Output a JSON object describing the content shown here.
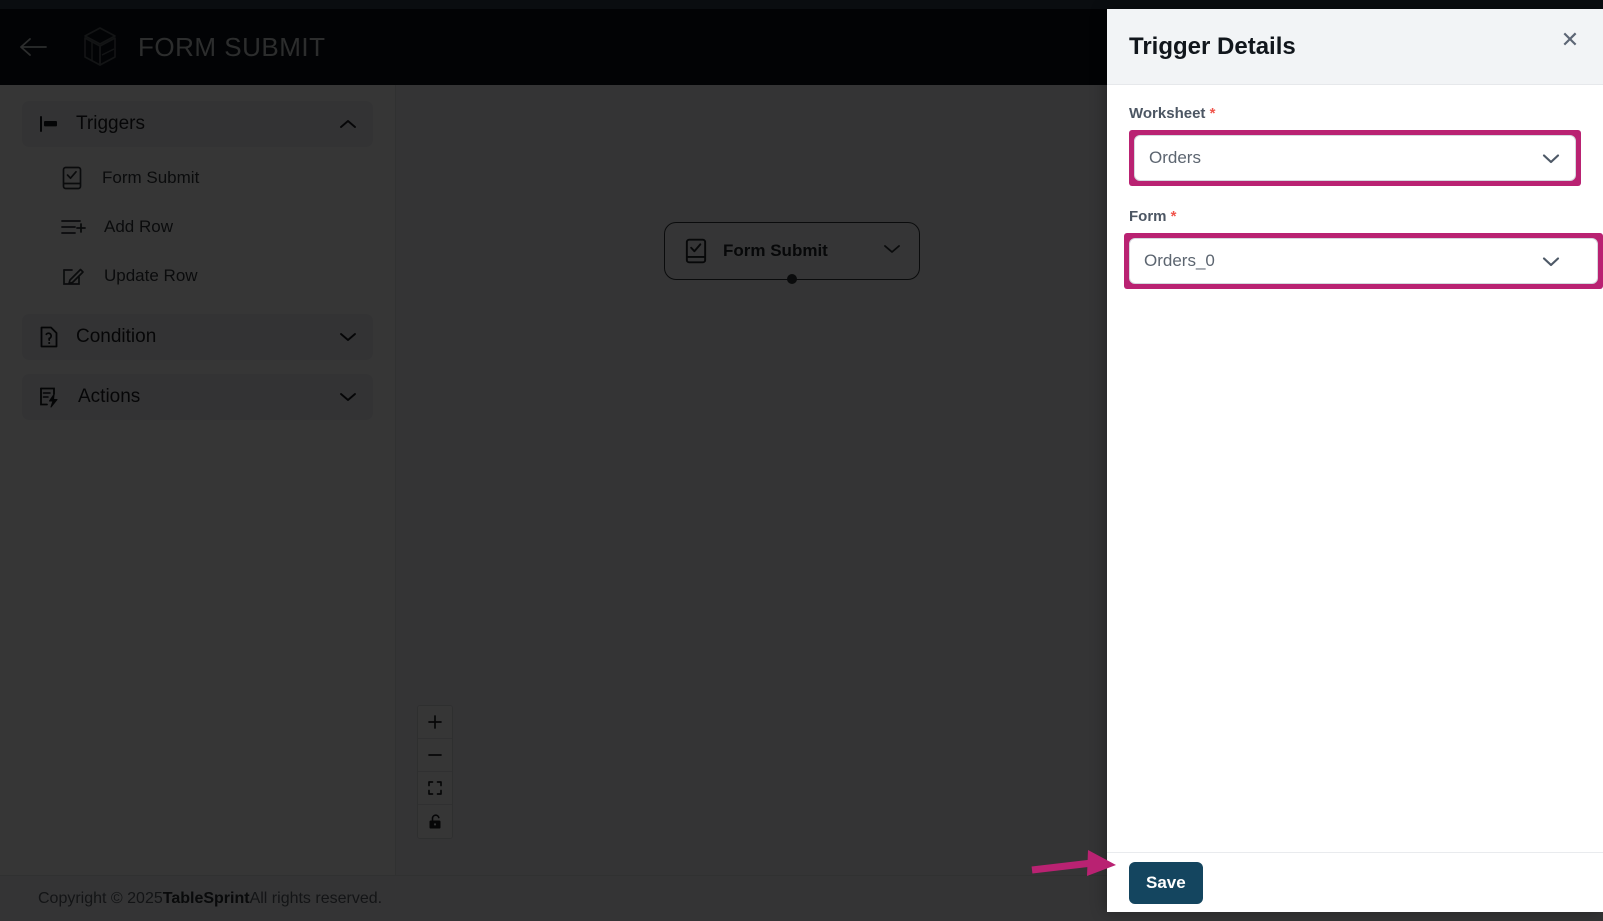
{
  "colors": {
    "accent_highlight": "#b92272",
    "save_button_bg": "#14455f",
    "header_dark": "#0b1219",
    "top_strip": "#333f4f",
    "required_star": "#f0554c"
  },
  "app": {
    "title": "FORM SUBMIT",
    "back_icon": "arrow-left-icon",
    "logo_icon": "cube-logo-icon"
  },
  "sidebar": {
    "groups": [
      {
        "label": "Triggers",
        "icon": "trigger-flag-icon",
        "chevron": "chevron-up-icon",
        "expanded": true,
        "items": [
          {
            "label": "Form Submit",
            "icon": "form-submit-icon"
          },
          {
            "label": "Add Row",
            "icon": "add-row-icon"
          },
          {
            "label": "Update Row",
            "icon": "update-row-icon"
          }
        ]
      },
      {
        "label": "Condition",
        "icon": "condition-question-doc-icon",
        "chevron": "chevron-down-icon",
        "expanded": false,
        "items": []
      },
      {
        "label": "Actions",
        "icon": "actions-lightning-doc-icon",
        "chevron": "chevron-down-icon",
        "expanded": false,
        "items": []
      }
    ]
  },
  "canvas": {
    "node": {
      "label": "Form Submit",
      "icon": "form-submit-icon",
      "chevron": "chevron-down-icon",
      "handle": "connection-dot"
    },
    "controls": [
      {
        "name": "zoom-in-button",
        "icon": "plus-icon"
      },
      {
        "name": "zoom-out-button",
        "icon": "minus-icon"
      },
      {
        "name": "fit-view-button",
        "icon": "fit-view-icon"
      },
      {
        "name": "lock-toggle-button",
        "icon": "lock-open-icon"
      }
    ]
  },
  "footer": {
    "prefix": "Copyright © 2025 ",
    "brand": "TableSprint",
    "suffix": " All rights reserved."
  },
  "drawer": {
    "title": "Trigger Details",
    "close_icon": "close-icon",
    "fields": [
      {
        "label": "Worksheet",
        "required": "*",
        "value": "Orders",
        "chevron": "chevron-down-icon",
        "highlighted": true
      },
      {
        "label": "Form",
        "required": "*",
        "value": "Orders_0",
        "chevron": "chevron-down-icon",
        "highlighted": true
      }
    ],
    "save_label": "Save"
  },
  "annotation": {
    "arrow": "pointer-arrow-to-save"
  }
}
